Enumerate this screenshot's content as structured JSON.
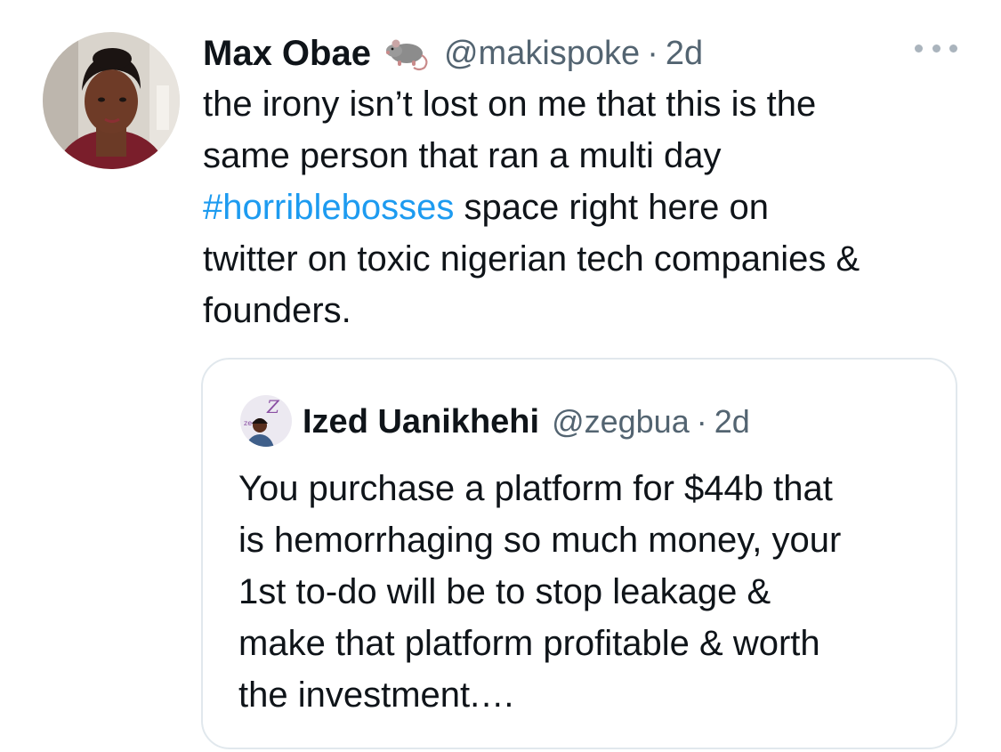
{
  "tweet": {
    "author_name": "Max Obae",
    "name_emoji_icon": "rat-icon",
    "handle": "@makispoke",
    "separator": "·",
    "time": "2d",
    "more_icon": "more-options-icon",
    "text_lines": {
      "line1": "the irony isn’t lost on me that this is the",
      "line2": "same person that ran a multi day",
      "hashtag": "#horriblebosses",
      "line3_rest": " space right here on",
      "line4": "twitter on toxic nigerian tech companies &",
      "line5": "founders."
    },
    "hashtag_color": "#1d9bf0"
  },
  "quoted_tweet": {
    "author_name": "Ized Uanikhehi",
    "handle": "@zegbua",
    "separator": "·",
    "time": "2d",
    "text_lines": [
      "You purchase a platform for $44b that",
      "is hemorrhaging so much money, your",
      "1st to-do will be to stop leakage &",
      "make that platform profitable & worth",
      "the investment.…"
    ]
  },
  "colors": {
    "text_primary": "#0f1419",
    "text_secondary": "#536471",
    "border": "#e1e8ed"
  }
}
